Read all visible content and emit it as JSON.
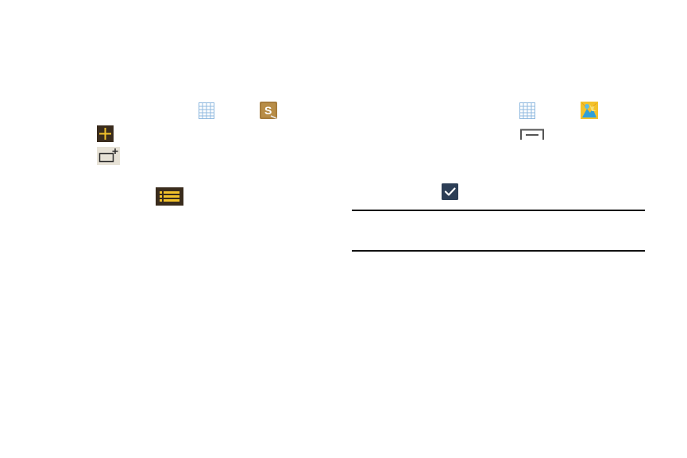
{
  "icons": {
    "apps_grid_left": "apps-grid-icon",
    "s_note_app": "s-note-app-icon",
    "add": "add-icon",
    "add_page": "add-page-icon",
    "list_view": "list-view-icon",
    "apps_grid_right": "apps-grid-icon",
    "gallery_app": "gallery-app-icon",
    "menu_key": "menu-key-icon",
    "done_check": "done-checkmark-icon"
  },
  "colors": {
    "dark_tile": "#3a2c1d",
    "accent_yellow": "#f3c22b",
    "s_note_brown": "#a67c3c",
    "grid_blue": "#8fb9df",
    "checkbox_navy": "#2c3e56",
    "rule": "#111111"
  }
}
